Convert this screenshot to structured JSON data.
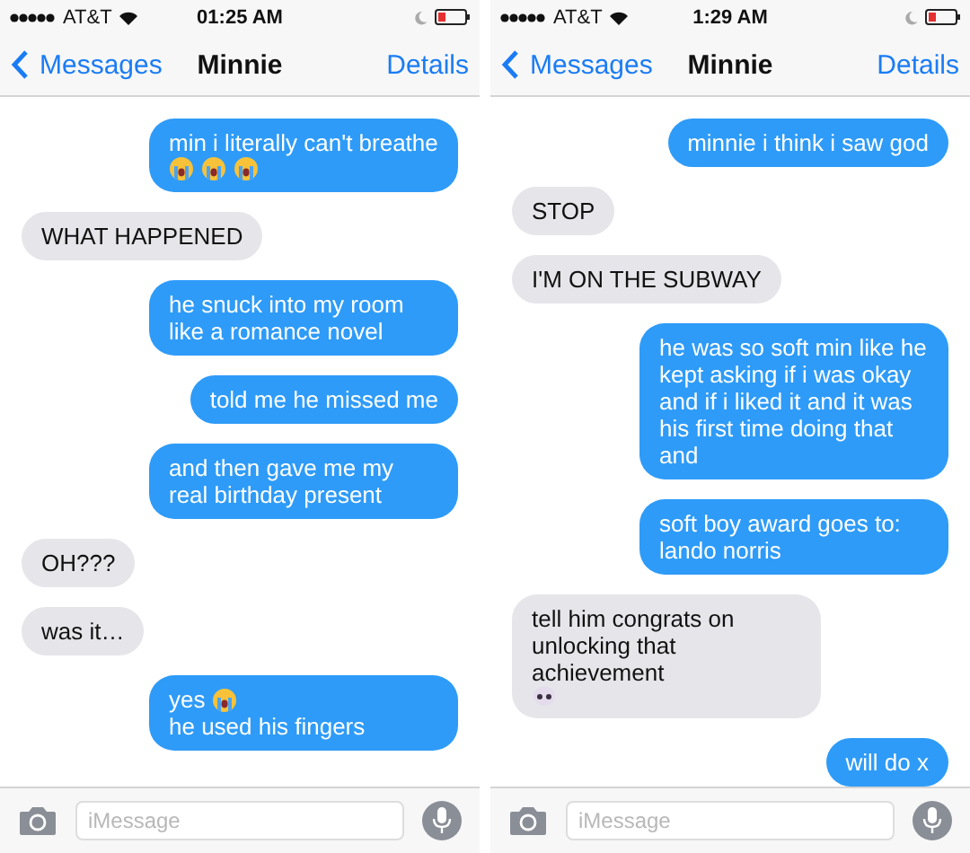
{
  "screens": [
    {
      "status": {
        "carrier": "AT&T",
        "time": "01:25 AM"
      },
      "nav": {
        "back": "Messages",
        "title": "Minnie",
        "action": "Details"
      },
      "messages": [
        {
          "kind": "sent",
          "parts": [
            {
              "kind": "text",
              "text": "min i literally can't breathe"
            },
            {
              "kind": "crying"
            },
            {
              "kind": "crying"
            },
            {
              "kind": "crying"
            }
          ]
        },
        {
          "kind": "received",
          "parts": [
            {
              "kind": "text",
              "text": "WHAT HAPPENED"
            }
          ]
        },
        {
          "kind": "sent",
          "parts": [
            {
              "kind": "text",
              "text": "he snuck into my room like a romance novel"
            }
          ]
        },
        {
          "kind": "sent",
          "parts": [
            {
              "kind": "text",
              "text": "told me he missed me"
            }
          ]
        },
        {
          "kind": "sent",
          "parts": [
            {
              "kind": "text",
              "text": "and then gave me my real birthday present"
            }
          ]
        },
        {
          "kind": "received",
          "parts": [
            {
              "kind": "text",
              "text": "OH???"
            }
          ]
        },
        {
          "kind": "received",
          "parts": [
            {
              "kind": "text",
              "text": "was it…"
            }
          ]
        },
        {
          "kind": "sent",
          "parts": [
            {
              "kind": "text",
              "text": "yes"
            },
            {
              "kind": "crying"
            },
            {
              "kind": "text",
              "text": "he used his fingers"
            }
          ]
        }
      ],
      "input": {
        "placeholder": "iMessage"
      }
    },
    {
      "status": {
        "carrier": "AT&T",
        "time": "1:29 AM"
      },
      "nav": {
        "back": "Messages",
        "title": "Minnie",
        "action": "Details"
      },
      "messages": [
        {
          "kind": "sent",
          "parts": [
            {
              "kind": "text",
              "text": "minnie i think i saw god"
            }
          ]
        },
        {
          "kind": "received",
          "parts": [
            {
              "kind": "text",
              "text": "STOP"
            }
          ]
        },
        {
          "kind": "received",
          "parts": [
            {
              "kind": "text",
              "text": "I'M ON THE SUBWAY"
            }
          ]
        },
        {
          "kind": "sent",
          "parts": [
            {
              "kind": "text",
              "text": "he was so soft min like he kept asking if i was okay and if i liked it and it was his first time doing that and"
            }
          ]
        },
        {
          "kind": "sent",
          "parts": [
            {
              "kind": "text",
              "text": "soft boy award goes to: lando norris"
            }
          ]
        },
        {
          "kind": "received",
          "parts": [
            {
              "kind": "text",
              "text": "tell him congrats on unlocking that achievement"
            },
            {
              "kind": "skull"
            }
          ]
        },
        {
          "kind": "sent",
          "parts": [
            {
              "kind": "text",
              "text": "will do x"
            }
          ]
        }
      ],
      "input": {
        "placeholder": "iMessage"
      }
    }
  ]
}
